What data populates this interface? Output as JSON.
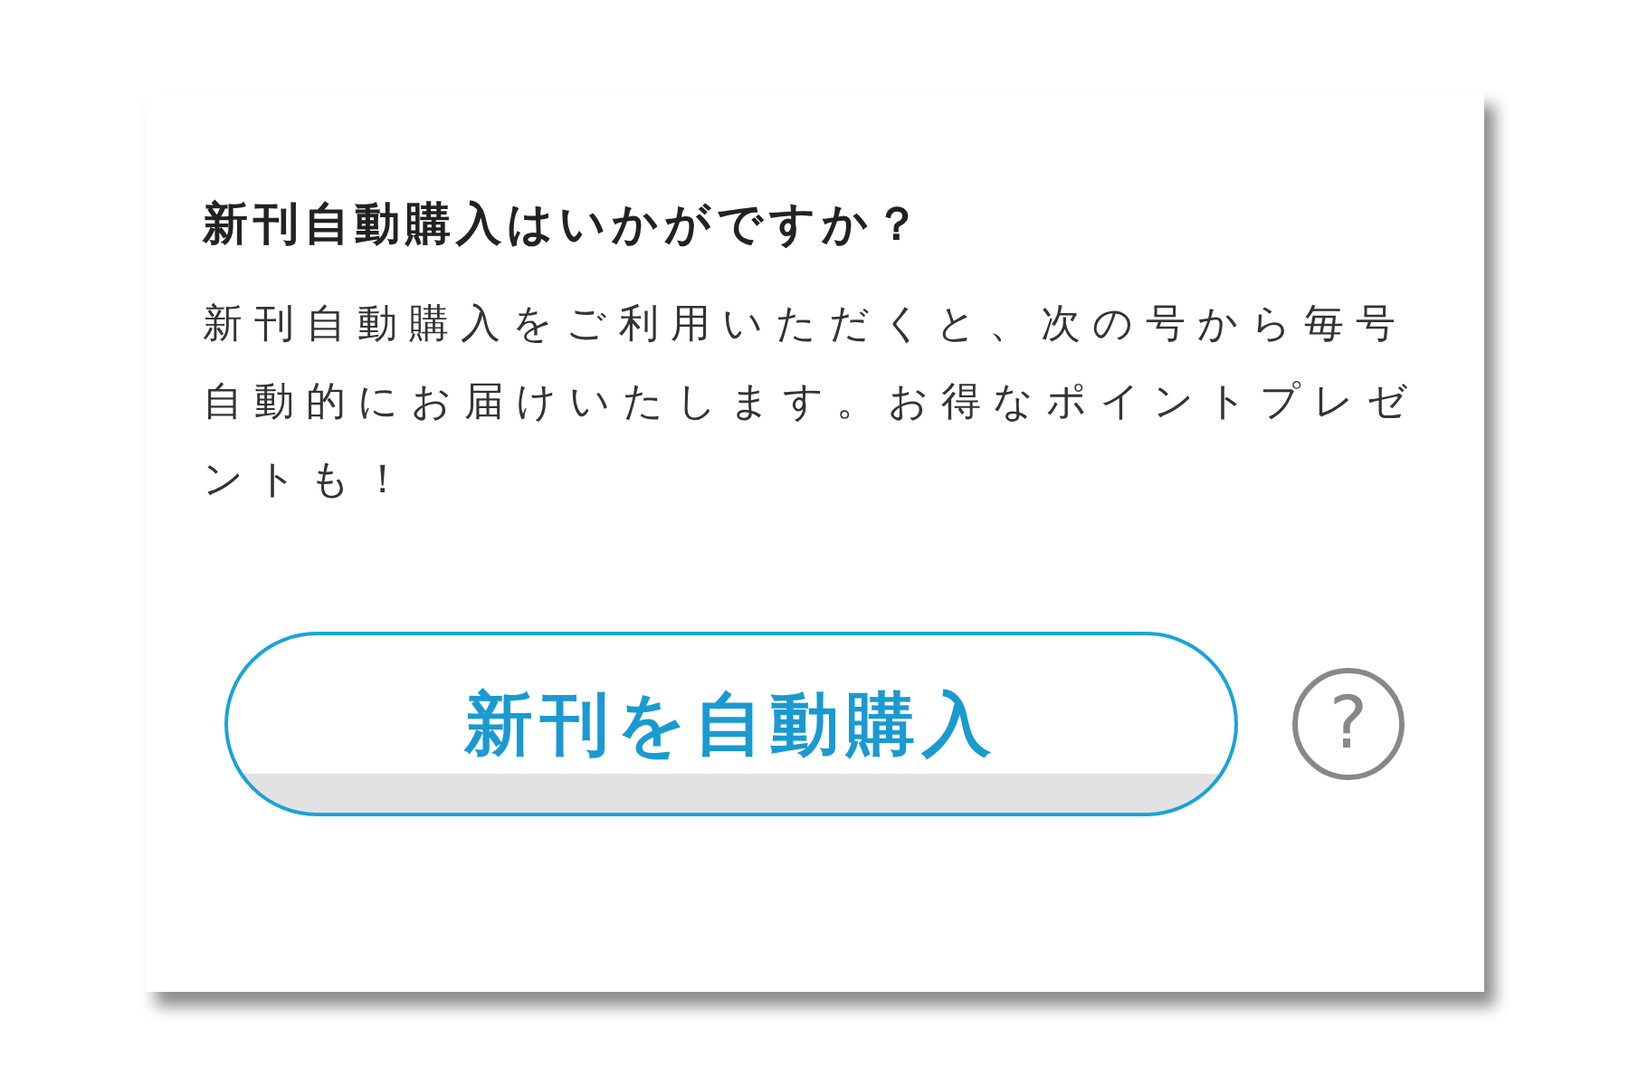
{
  "card": {
    "title": "新刊自動購入はいかがですか？",
    "description": "新刊自動購入をご利用いただくと、次の号から毎号自動的にお届けいたします。お得なポイントプレゼントも！",
    "button": "新刊を自動購入",
    "help": "?"
  }
}
